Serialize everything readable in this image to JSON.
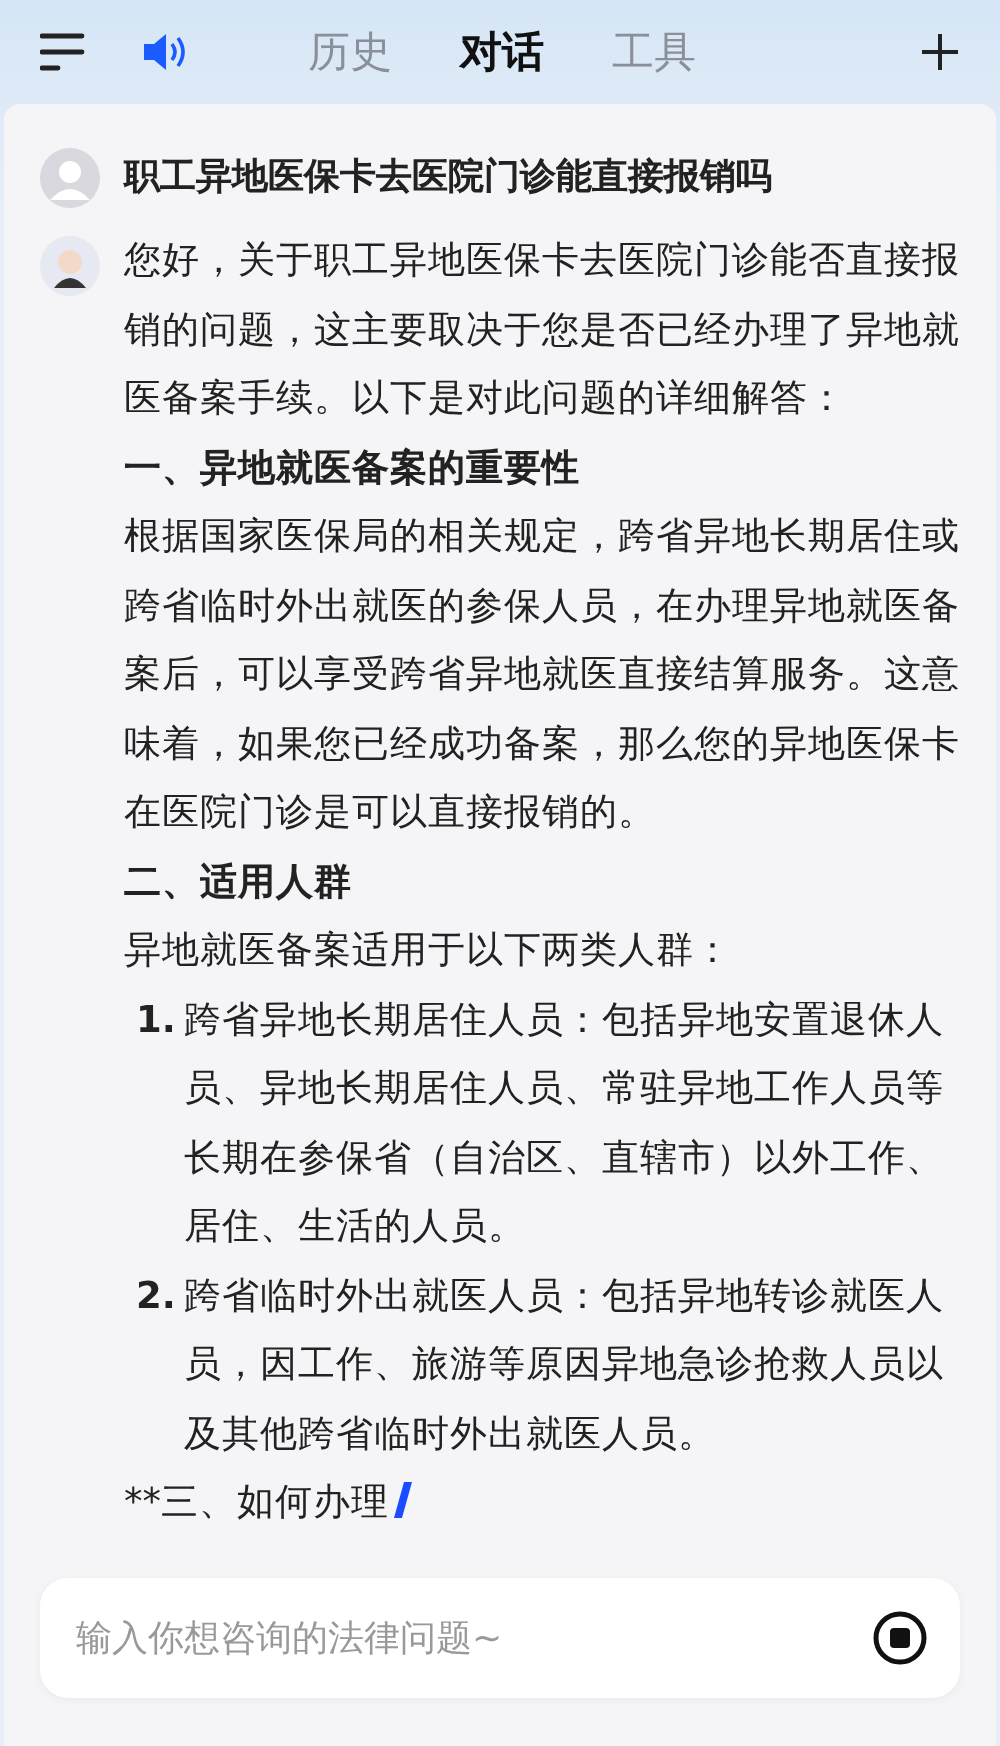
{
  "tabs": [
    {
      "label": "历史",
      "selected": false
    },
    {
      "label": "对话",
      "selected": true
    },
    {
      "label": "工具",
      "selected": false
    }
  ],
  "question": {
    "text": "职工异地医保卡去医院门诊能直接报销吗"
  },
  "answer": {
    "streaming": true,
    "blocks": [
      {
        "kind": "paragraph",
        "text": "您好，关于职工异地医保卡去医院门诊能否直接报销的问题，这主要取决于您是否已经办理了异地就医备案手续。以下是对此问题的详细解答："
      },
      {
        "kind": "heading",
        "text": "一、异地就医备案的重要性"
      },
      {
        "kind": "paragraph",
        "text": "根据国家医保局的相关规定，跨省异地长期居住或跨省临时外出就医的参保人员，在办理异地就医备案后，可以享受跨省异地就医直接结算服务。这意味着，如果您已经成功备案，那么您的异地医保卡在医院门诊是可以直接报销的。"
      },
      {
        "kind": "heading",
        "text": "二、适用人群"
      },
      {
        "kind": "paragraph",
        "text": "异地就医备案适用于以下两类人群："
      },
      {
        "kind": "list",
        "items": [
          {
            "number": "1.",
            "text": "跨省异地长期居住人员：包括异地安置退休人员、异地长期居住人员、常驻异地工作人员等长期在参保省（自治区、直辖市）以外工作、居住、生活的人员。"
          },
          {
            "number": "2.",
            "text": "跨省临时外出就医人员：包括异地转诊就医人员，因工作、旅游等原因异地急诊抢救人员以及其他跨省临时外出就医人员。"
          }
        ]
      },
      {
        "kind": "paragraph",
        "text": "**三、如何办理"
      }
    ]
  },
  "input": {
    "placeholder": "输入你想咨询的法律问题~"
  }
}
